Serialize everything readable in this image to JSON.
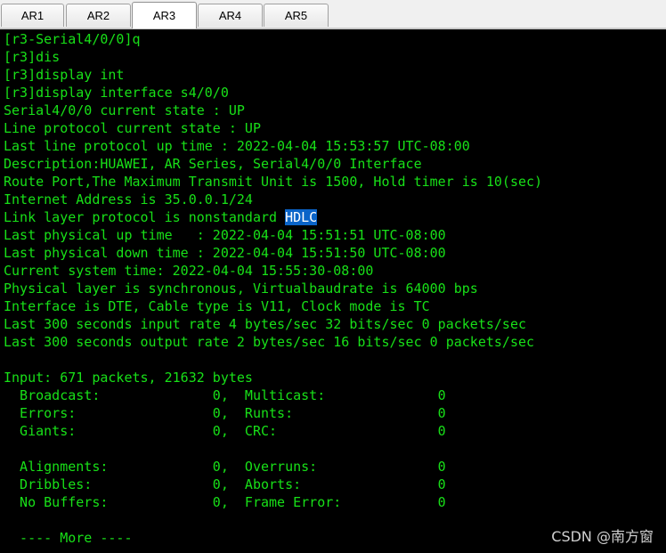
{
  "tabs": [
    {
      "label": "AR1",
      "active": false
    },
    {
      "label": "AR2",
      "active": false
    },
    {
      "label": "AR3",
      "active": true
    },
    {
      "label": "AR4",
      "active": false
    },
    {
      "label": "AR5",
      "active": false
    }
  ],
  "terminal": {
    "text_color": "#18e018",
    "background": "#000000",
    "highlight_color": "#0a64c8",
    "lines": [
      "[r3-Serial4/0/0]q",
      "[r3]dis",
      "[r3]display int",
      "[r3]display interface s4/0/0",
      "Serial4/0/0 current state : UP",
      "Line protocol current state : UP",
      "Last line protocol up time : 2022-04-04 15:53:57 UTC-08:00",
      "Description:HUAWEI, AR Series, Serial4/0/0 Interface",
      "Route Port,The Maximum Transmit Unit is 1500, Hold timer is 10(sec)",
      "Internet Address is 35.0.0.1/24",
      "Link layer protocol is nonstandard ",
      "Last physical up time   : 2022-04-04 15:51:51 UTC-08:00",
      "Last physical down time : 2022-04-04 15:51:50 UTC-08:00",
      "Current system time: 2022-04-04 15:55:30-08:00",
      "Physical layer is synchronous, Virtualbaudrate is 64000 bps",
      "Interface is DTE, Cable type is V11, Clock mode is TC",
      "Last 300 seconds input rate 4 bytes/sec 32 bits/sec 0 packets/sec",
      "Last 300 seconds output rate 2 bytes/sec 16 bits/sec 0 packets/sec",
      "",
      "Input: 671 packets, 21632 bytes",
      "  Broadcast:              0,  Multicast:              0",
      "  Errors:                 0,  Runts:                  0",
      "  Giants:                 0,  CRC:                    0",
      "",
      "  Alignments:             0,  Overruns:               0",
      "  Dribbles:               0,  Aborts:                 0",
      "  No Buffers:             0,  Frame Error:            0",
      "",
      "  ---- More ----"
    ],
    "highlighted_text": "HDLC"
  },
  "watermark": "CSDN @南方窗"
}
